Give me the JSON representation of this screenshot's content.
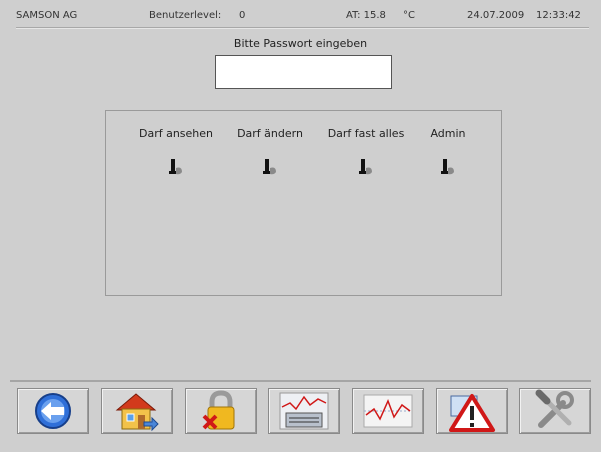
{
  "status": {
    "company": "SAMSON AG",
    "user_level_label": "Benutzerlevel:",
    "user_level_value": "0",
    "at_label": "AT: 15.8",
    "at_unit": "°C",
    "date": "24.07.2009",
    "time": "12:33:42"
  },
  "password": {
    "prompt": "Bitte Passwort eingeben",
    "value": ""
  },
  "levels": [
    {
      "label": "Darf ansehen",
      "icon": "key-switch-icon"
    },
    {
      "label": "Darf ändern",
      "icon": "key-switch-icon"
    },
    {
      "label": "Darf fast alles",
      "icon": "key-switch-icon"
    },
    {
      "label": "Admin",
      "icon": "key-switch-icon"
    }
  ],
  "toolbar": [
    {
      "icon": "back-arrow-icon"
    },
    {
      "icon": "home-icon"
    },
    {
      "icon": "lock-icon"
    },
    {
      "icon": "device-chart-icon"
    },
    {
      "icon": "trend-chart-icon"
    },
    {
      "icon": "warning-icon"
    },
    {
      "icon": "tools-icon"
    }
  ],
  "colors": {
    "background": "#cfcfcf",
    "accent_blue": "#2f6fd8",
    "warning_red": "#d01818"
  }
}
